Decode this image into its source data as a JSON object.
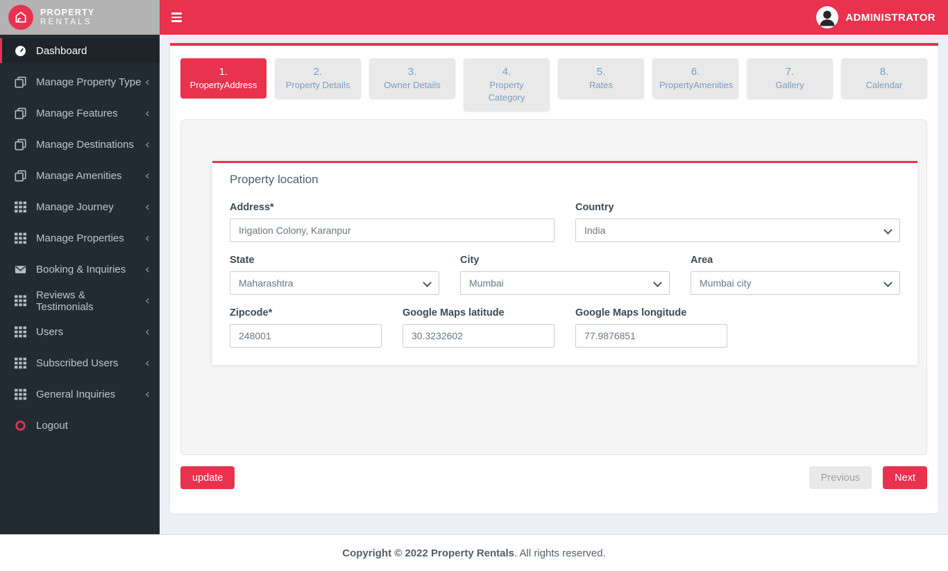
{
  "brand": {
    "line1": "PROPERTY",
    "line2": "RENTALS"
  },
  "header": {
    "user_label": "ADMINISTRATOR"
  },
  "sidebar": {
    "items": [
      {
        "label": "Dashboard",
        "icon": "dashboard-icon",
        "active": true
      },
      {
        "label": "Manage Property Type",
        "icon": "copy-icon",
        "chevron": "‹"
      },
      {
        "label": "Manage Features",
        "icon": "copy-icon",
        "chevron": "‹"
      },
      {
        "label": "Manage Destinations",
        "icon": "copy-icon",
        "chevron": "‹"
      },
      {
        "label": "Manage Amenities",
        "icon": "copy-icon",
        "chevron": "‹"
      },
      {
        "label": "Manage Journey",
        "icon": "grid-icon",
        "chevron": "‹"
      },
      {
        "label": "Manage Properties",
        "icon": "grid-icon",
        "chevron": "‹"
      },
      {
        "label": "Booking & Inquiries",
        "icon": "envelope-icon",
        "chevron": "‹"
      },
      {
        "label": "Reviews & Testimonials",
        "icon": "grid-icon",
        "chevron": "‹"
      },
      {
        "label": "Users",
        "icon": "grid-icon",
        "chevron": "‹"
      },
      {
        "label": "Subscribed Users",
        "icon": "grid-icon",
        "chevron": "‹"
      },
      {
        "label": "General Inquiries",
        "icon": "grid-icon",
        "chevron": "‹"
      },
      {
        "label": "Logout",
        "icon": "logout-ring-icon"
      }
    ]
  },
  "wizard": {
    "steps": [
      {
        "number": "1.",
        "label": "PropertyAddress",
        "active": true
      },
      {
        "number": "2.",
        "label": "Property Details"
      },
      {
        "number": "3.",
        "label": "Owner Details"
      },
      {
        "number": "4.",
        "label": "Property Category"
      },
      {
        "number": "5.",
        "label": "Rates"
      },
      {
        "number": "6.",
        "label": "PropertyAmenities"
      },
      {
        "number": "7.",
        "label": "Gallery"
      },
      {
        "number": "8.",
        "label": "Calendar"
      }
    ]
  },
  "form": {
    "title": "Property location",
    "address": {
      "label": "Address*",
      "value": "Irigation Colony, Karanpur"
    },
    "country": {
      "label": "Country",
      "value": "India"
    },
    "state": {
      "label": "State",
      "value": "Maharashtra"
    },
    "city": {
      "label": "City",
      "value": "Mumbai"
    },
    "area": {
      "label": "Area",
      "value": "Mumbai city"
    },
    "zipcode": {
      "label": "Zipcode*",
      "value": "248001"
    },
    "latitude": {
      "label": "Google Maps latitude",
      "value": "30.3232602"
    },
    "longitude": {
      "label": "Google Maps longitude",
      "value": "77.9876851"
    }
  },
  "buttons": {
    "update": "update",
    "previous": "Previous",
    "next": "Next"
  },
  "footer": {
    "bold": "Copyright © 2022 Property Rentals",
    "rest": " . All rights reserved."
  },
  "colors": {
    "accent": "#e8324e",
    "sidebar_bg": "#232b32",
    "page_bg": "#edeff6",
    "logo_bg": "#b3b3b3",
    "step_text": "#7b9dc2",
    "step_bg": "#e9e9e9"
  }
}
